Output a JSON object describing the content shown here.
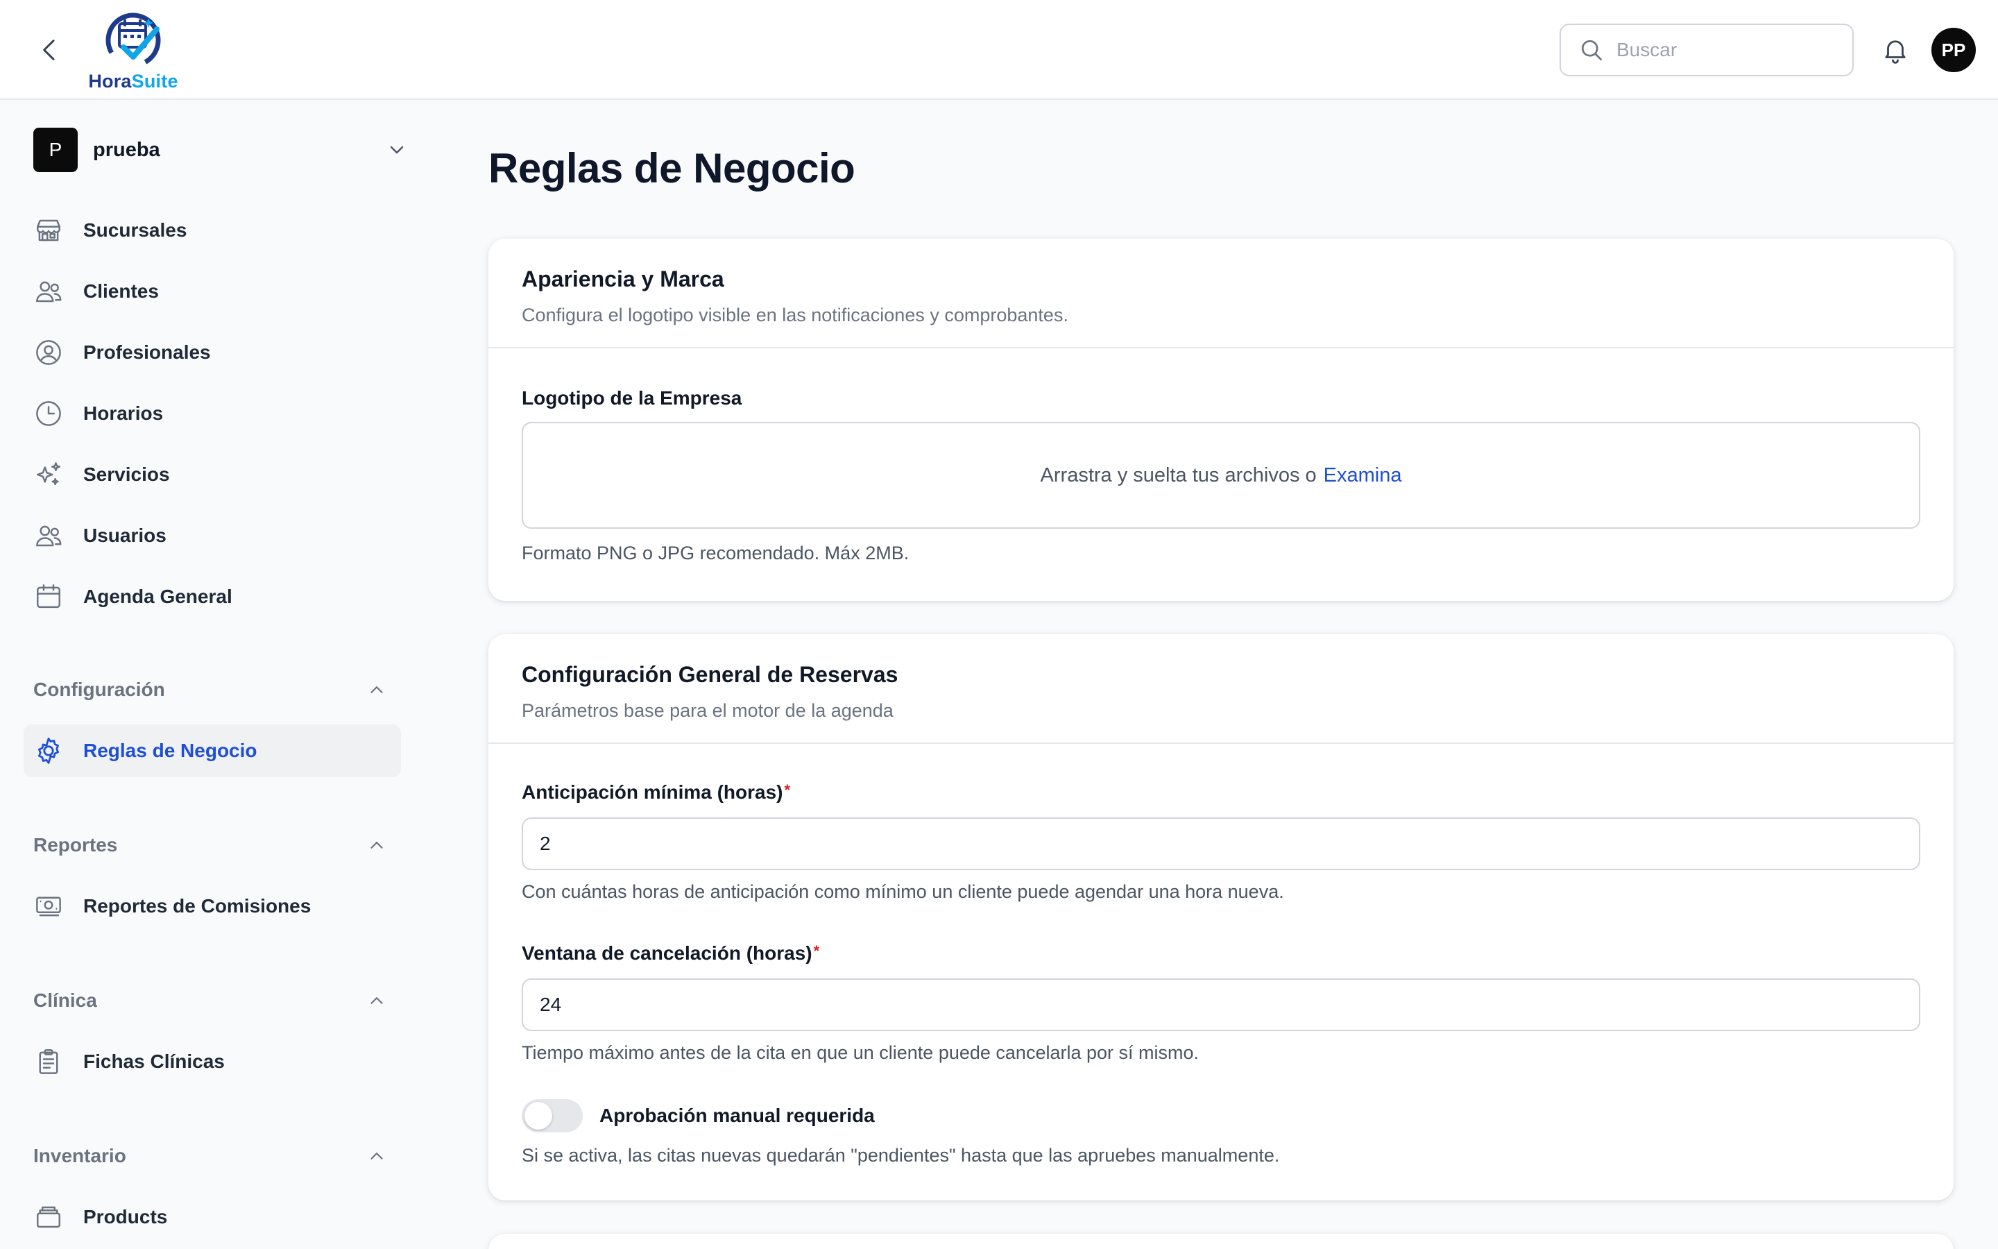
{
  "app": {
    "brand_part1": "Hora",
    "brand_part2": "Suite",
    "brand_colors": {
      "dark": "#1e3a8a",
      "light": "#0ea5e9"
    }
  },
  "header": {
    "search_placeholder": "Buscar",
    "avatar_initials": "PP"
  },
  "sidebar": {
    "org": {
      "initial": "P",
      "name": "prueba"
    },
    "items": [
      {
        "label": "Sucursales",
        "icon": "store-icon"
      },
      {
        "label": "Clientes",
        "icon": "users-icon"
      },
      {
        "label": "Profesionales",
        "icon": "user-circle-icon"
      },
      {
        "label": "Horarios",
        "icon": "clock-icon"
      },
      {
        "label": "Servicios",
        "icon": "sparkles-icon"
      },
      {
        "label": "Usuarios",
        "icon": "users-icon"
      },
      {
        "label": "Agenda General",
        "icon": "calendar-icon"
      }
    ],
    "sections": [
      {
        "label": "Configuración",
        "items": [
          {
            "label": "Reglas de Negocio",
            "icon": "gear-icon",
            "active": true
          }
        ]
      },
      {
        "label": "Reportes",
        "items": [
          {
            "label": "Reportes de Comisiones",
            "icon": "money-icon"
          }
        ]
      },
      {
        "label": "Clínica",
        "items": [
          {
            "label": "Fichas Clínicas",
            "icon": "clipboard-icon"
          }
        ]
      },
      {
        "label": "Inventario",
        "items": [
          {
            "label": "Products",
            "icon": "box-icon"
          }
        ]
      }
    ],
    "active_color": "#1d4ed8"
  },
  "main": {
    "title": "Reglas de Negocio",
    "branding_card": {
      "title": "Apariencia y Marca",
      "subtitle": "Configura el logotipo visible en las notificaciones y comprobantes.",
      "logo_label": "Logotipo de la Empresa",
      "dropzone_text": "Arrastra y suelta tus archivos o",
      "dropzone_link": "Examina",
      "help": "Formato PNG o JPG recomendado. Máx 2MB."
    },
    "booking_card": {
      "title": "Configuración General de Reservas",
      "subtitle": "Parámetros base para el motor de la agenda",
      "min_advance": {
        "label": "Anticipación mínima (horas)",
        "required_mark": "*",
        "value": "2",
        "help": "Con cuántas horas de anticipación como mínimo un cliente puede agendar una hora nueva."
      },
      "cancel_window": {
        "label": "Ventana de cancelación (horas)",
        "required_mark": "*",
        "value": "24",
        "help": "Tiempo máximo antes de la cita en que un cliente puede cancelarla por sí mismo."
      },
      "manual_approval": {
        "label": "Aprobación manual requerida",
        "enabled": false,
        "help": "Si se activa, las citas nuevas quedarán \"pendientes\" hasta que las apruebes manualmente."
      }
    }
  }
}
